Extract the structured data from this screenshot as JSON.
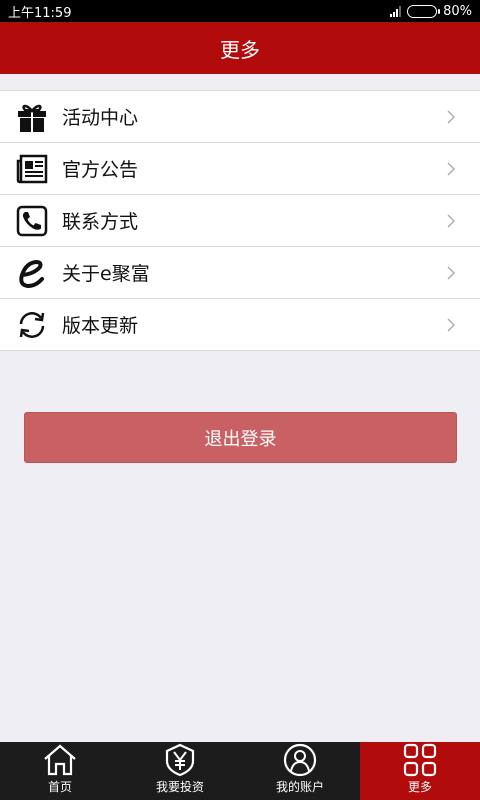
{
  "status_bar": {
    "time": "上午11:59",
    "battery": "80%",
    "battery_level": 0.8
  },
  "header": {
    "title": "更多"
  },
  "menu": {
    "items": [
      {
        "label": "活动中心",
        "icon": "gift-icon"
      },
      {
        "label": "官方公告",
        "icon": "newspaper-icon"
      },
      {
        "label": "联系方式",
        "icon": "phone-icon"
      },
      {
        "label": "关于e聚富",
        "icon": "e-logo-icon"
      },
      {
        "label": "版本更新",
        "icon": "refresh-icon"
      }
    ]
  },
  "logout": {
    "label": "退出登录"
  },
  "tabbar": {
    "tabs": [
      {
        "label": "首页",
        "icon": "home-icon"
      },
      {
        "label": "我要投资",
        "icon": "yen-shield-icon"
      },
      {
        "label": "我的账户",
        "icon": "user-icon"
      },
      {
        "label": "更多",
        "icon": "grid-icon",
        "active": true
      }
    ]
  },
  "colors": {
    "brand_red": "#b10b0b",
    "logout_button": "#c96164",
    "background": "#efeef3",
    "tabbar": "#1c1c1c"
  }
}
